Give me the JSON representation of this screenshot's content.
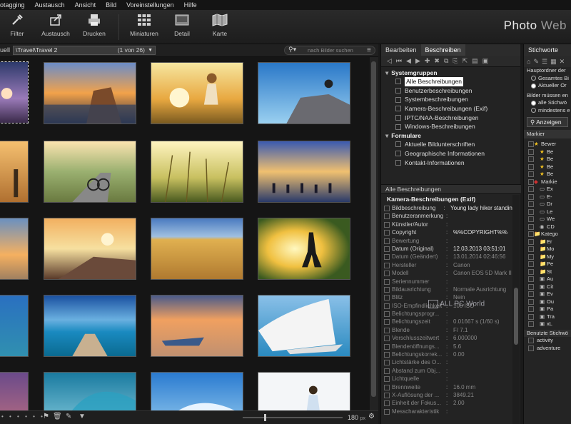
{
  "menu": [
    "otagging",
    "Austausch",
    "Ansicht",
    "Bild",
    "Voreinstellungen",
    "Hilfe"
  ],
  "toolbar": {
    "filter": "Filter",
    "austausch": "Austausch",
    "drucken": "Drucken",
    "miniaturen": "Miniaturen",
    "detail": "Detail",
    "karte": "Karte"
  },
  "brand": {
    "photo": "Photo",
    "web": "Web"
  },
  "pathbar": {
    "left_label": "uell",
    "path": "\\Travel\\Travel 2",
    "count": "(1 von 26)",
    "search_placeholder": "nach Bilder suchen"
  },
  "bottombar": {
    "size": "180",
    "unit": "px"
  },
  "mid": {
    "tabs": [
      "Bearbeiten",
      "Beschreiben"
    ],
    "groups": [
      {
        "label": "Systemgruppen",
        "items": [
          "Alle Beschreibungen",
          "Benutzerbeschreibungen",
          "Systembeschreibungen",
          "Kamera-Beschreibungen (Exif)",
          "IPTC/NAA-Beschreibungen",
          "Windows-Beschreibungen"
        ]
      },
      {
        "label": "Formulare",
        "items": [
          "Aktuelle Bildunterschriften",
          "Geographische Informationen",
          "Kontakt-Informationen"
        ]
      }
    ],
    "section": "Alle Beschreibungen",
    "props_title": "Kamera-Beschreibungen (Exif)",
    "props": [
      {
        "k": "Bildbeschreibung",
        "v": "Young lady hiker standing",
        "dim": false
      },
      {
        "k": "Benutzeranmerkung",
        "v": "",
        "dim": false
      },
      {
        "k": "Künstler/Autor",
        "v": "",
        "dim": false
      },
      {
        "k": "Copyright",
        "v": "%%COPYRIGHT%%",
        "dim": false
      },
      {
        "k": "Bewertung",
        "v": "",
        "dim": true
      },
      {
        "k": "Datum (Original)",
        "v": "12.03.2013 03:51:01",
        "dim": false
      },
      {
        "k": "Datum (Geändert)",
        "v": "13.01.2014 02:46:56",
        "dim": true
      },
      {
        "k": "Hersteller",
        "v": "Canon",
        "dim": true
      },
      {
        "k": "Modell",
        "v": "Canon EOS 5D Mark II",
        "dim": true
      },
      {
        "k": "Seriennummer",
        "v": "",
        "dim": true
      },
      {
        "k": "Bildausrichtung",
        "v": "Normale Ausrichtung",
        "dim": true
      },
      {
        "k": "Blitz",
        "v": "Nein",
        "dim": true
      },
      {
        "k": "ISO-Empfindlichkeit",
        "v": "100 ISO",
        "dim": true
      },
      {
        "k": "Belichtungsprogr...",
        "v": "",
        "dim": true
      },
      {
        "k": "Belichtungszeit",
        "v": "0.01667 s (1/60 s)",
        "dim": true
      },
      {
        "k": "Blende",
        "v": "F/ 7.1",
        "dim": true
      },
      {
        "k": "Verschlusszeitwert",
        "v": "6.000000",
        "dim": true
      },
      {
        "k": "Blendenöffnungs...",
        "v": "5.6",
        "dim": true
      },
      {
        "k": "Belichtungskorrek...",
        "v": "0.00",
        "dim": true
      },
      {
        "k": "Lichtstärke des O...",
        "v": "",
        "dim": true
      },
      {
        "k": "Abstand zum Obj...",
        "v": "",
        "dim": true
      },
      {
        "k": "Lichtquelle",
        "v": "",
        "dim": true
      },
      {
        "k": "Brennweite",
        "v": "16.0 mm",
        "dim": true
      },
      {
        "k": "X-Auflösung der ...",
        "v": "3849.21",
        "dim": true
      },
      {
        "k": "Einheit der Fokus...",
        "v": "2.00",
        "dim": true
      },
      {
        "k": "Messcharakteristik",
        "v": "",
        "dim": true
      }
    ],
    "watermark": "ALL PC World"
  },
  "right": {
    "header": "Stichworte",
    "hauptordner": "Hauptordner der",
    "radio1": [
      "Gesamtes Bi",
      "Aktueller Or"
    ],
    "bilder": "Bilder müssen en",
    "radio2": [
      "alle Stichwö",
      "mindestens e"
    ],
    "anzeigen": "Anzeigen",
    "markiert": "Markier",
    "tree": [
      "Bewer",
      "Be",
      "Be",
      "Be",
      "Be",
      "Markie",
      "Ex",
      "E-",
      "Dr",
      "Le",
      "We",
      "CD",
      "Katego",
      "Er",
      "Mo",
      "My",
      "Pe",
      "St",
      "Au",
      "Cit",
      "Ev",
      "Ou",
      "Pa",
      "Tra",
      "xL"
    ],
    "benutzte": "Benutzte Stichwö",
    "used": [
      "activity",
      "adventure"
    ]
  }
}
